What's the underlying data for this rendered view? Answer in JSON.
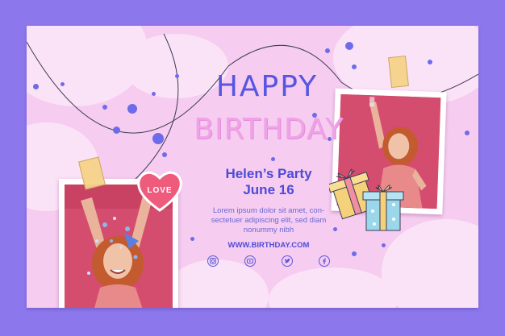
{
  "card": {
    "title_line1": "HAPPY",
    "title_line2": "BIRTHDAY",
    "event_name": "Helen’s Party",
    "event_date": "June 16",
    "body_line1": "Lorem ipsum dolor sit amet, con-",
    "body_line2": "sectetuer adipiscing elit, sed diam",
    "body_line3": "nonummy nibh",
    "website": "WWW.BIRTHDAY.COM",
    "heart_label": "LOVE"
  },
  "socials": [
    "instagram-icon",
    "youtube-icon",
    "twitter-icon",
    "facebook-icon"
  ],
  "colors": {
    "background": "#8c78ec",
    "card": "#f6cdf0",
    "accent_blue": "#5856e0",
    "accent_pink": "#f0a2e8",
    "photo_bg": "#d14a6a"
  }
}
